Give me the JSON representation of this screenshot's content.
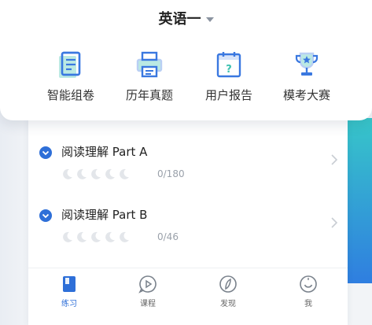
{
  "header": {
    "subject": "英语一"
  },
  "tools": [
    {
      "label": "智能组卷",
      "icon": "smart-paper-icon"
    },
    {
      "label": "历年真题",
      "icon": "printer-icon"
    },
    {
      "label": "用户报告",
      "icon": "calendar-report-icon"
    },
    {
      "label": "模考大赛",
      "icon": "trophy-icon"
    }
  ],
  "items": [
    {
      "title": "阅读理解 Part A",
      "count": "0/180",
      "stars_total": 5,
      "stars_filled": 0
    },
    {
      "title": "阅读理解 Part B",
      "count": "0/46",
      "stars_total": 5,
      "stars_filled": 0
    }
  ],
  "nav": [
    {
      "label": "练习",
      "icon": "practice-book-icon",
      "active": true
    },
    {
      "label": "课程",
      "icon": "course-play-icon",
      "active": false
    },
    {
      "label": "发现",
      "icon": "compass-leaf-icon",
      "active": false
    },
    {
      "label": "我",
      "icon": "smile-face-icon",
      "active": false
    }
  ],
  "colors": {
    "accent": "#2e6fd8",
    "icon_blue": "#3a78e0",
    "icon_green": "#3cc1b0",
    "muted": "#9aa1aa"
  }
}
